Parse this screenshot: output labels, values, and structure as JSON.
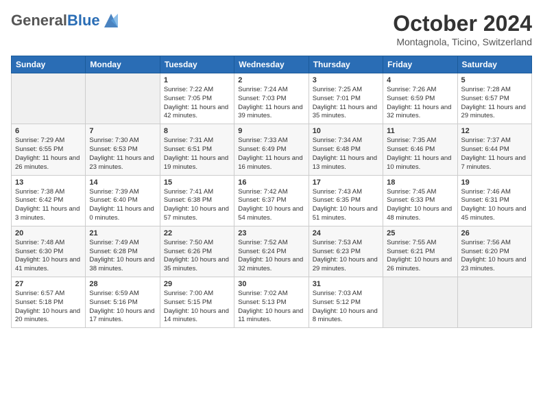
{
  "header": {
    "logo_general": "General",
    "logo_blue": "Blue",
    "title": "October 2024",
    "location": "Montagnola, Ticino, Switzerland"
  },
  "weekdays": [
    "Sunday",
    "Monday",
    "Tuesday",
    "Wednesday",
    "Thursday",
    "Friday",
    "Saturday"
  ],
  "weeks": [
    [
      {
        "day": "",
        "sunrise": "",
        "sunset": "",
        "daylight": ""
      },
      {
        "day": "",
        "sunrise": "",
        "sunset": "",
        "daylight": ""
      },
      {
        "day": "1",
        "sunrise": "Sunrise: 7:22 AM",
        "sunset": "Sunset: 7:05 PM",
        "daylight": "Daylight: 11 hours and 42 minutes."
      },
      {
        "day": "2",
        "sunrise": "Sunrise: 7:24 AM",
        "sunset": "Sunset: 7:03 PM",
        "daylight": "Daylight: 11 hours and 39 minutes."
      },
      {
        "day": "3",
        "sunrise": "Sunrise: 7:25 AM",
        "sunset": "Sunset: 7:01 PM",
        "daylight": "Daylight: 11 hours and 35 minutes."
      },
      {
        "day": "4",
        "sunrise": "Sunrise: 7:26 AM",
        "sunset": "Sunset: 6:59 PM",
        "daylight": "Daylight: 11 hours and 32 minutes."
      },
      {
        "day": "5",
        "sunrise": "Sunrise: 7:28 AM",
        "sunset": "Sunset: 6:57 PM",
        "daylight": "Daylight: 11 hours and 29 minutes."
      }
    ],
    [
      {
        "day": "6",
        "sunrise": "Sunrise: 7:29 AM",
        "sunset": "Sunset: 6:55 PM",
        "daylight": "Daylight: 11 hours and 26 minutes."
      },
      {
        "day": "7",
        "sunrise": "Sunrise: 7:30 AM",
        "sunset": "Sunset: 6:53 PM",
        "daylight": "Daylight: 11 hours and 23 minutes."
      },
      {
        "day": "8",
        "sunrise": "Sunrise: 7:31 AM",
        "sunset": "Sunset: 6:51 PM",
        "daylight": "Daylight: 11 hours and 19 minutes."
      },
      {
        "day": "9",
        "sunrise": "Sunrise: 7:33 AM",
        "sunset": "Sunset: 6:49 PM",
        "daylight": "Daylight: 11 hours and 16 minutes."
      },
      {
        "day": "10",
        "sunrise": "Sunrise: 7:34 AM",
        "sunset": "Sunset: 6:48 PM",
        "daylight": "Daylight: 11 hours and 13 minutes."
      },
      {
        "day": "11",
        "sunrise": "Sunrise: 7:35 AM",
        "sunset": "Sunset: 6:46 PM",
        "daylight": "Daylight: 11 hours and 10 minutes."
      },
      {
        "day": "12",
        "sunrise": "Sunrise: 7:37 AM",
        "sunset": "Sunset: 6:44 PM",
        "daylight": "Daylight: 11 hours and 7 minutes."
      }
    ],
    [
      {
        "day": "13",
        "sunrise": "Sunrise: 7:38 AM",
        "sunset": "Sunset: 6:42 PM",
        "daylight": "Daylight: 11 hours and 3 minutes."
      },
      {
        "day": "14",
        "sunrise": "Sunrise: 7:39 AM",
        "sunset": "Sunset: 6:40 PM",
        "daylight": "Daylight: 11 hours and 0 minutes."
      },
      {
        "day": "15",
        "sunrise": "Sunrise: 7:41 AM",
        "sunset": "Sunset: 6:38 PM",
        "daylight": "Daylight: 10 hours and 57 minutes."
      },
      {
        "day": "16",
        "sunrise": "Sunrise: 7:42 AM",
        "sunset": "Sunset: 6:37 PM",
        "daylight": "Daylight: 10 hours and 54 minutes."
      },
      {
        "day": "17",
        "sunrise": "Sunrise: 7:43 AM",
        "sunset": "Sunset: 6:35 PM",
        "daylight": "Daylight: 10 hours and 51 minutes."
      },
      {
        "day": "18",
        "sunrise": "Sunrise: 7:45 AM",
        "sunset": "Sunset: 6:33 PM",
        "daylight": "Daylight: 10 hours and 48 minutes."
      },
      {
        "day": "19",
        "sunrise": "Sunrise: 7:46 AM",
        "sunset": "Sunset: 6:31 PM",
        "daylight": "Daylight: 10 hours and 45 minutes."
      }
    ],
    [
      {
        "day": "20",
        "sunrise": "Sunrise: 7:48 AM",
        "sunset": "Sunset: 6:30 PM",
        "daylight": "Daylight: 10 hours and 41 minutes."
      },
      {
        "day": "21",
        "sunrise": "Sunrise: 7:49 AM",
        "sunset": "Sunset: 6:28 PM",
        "daylight": "Daylight: 10 hours and 38 minutes."
      },
      {
        "day": "22",
        "sunrise": "Sunrise: 7:50 AM",
        "sunset": "Sunset: 6:26 PM",
        "daylight": "Daylight: 10 hours and 35 minutes."
      },
      {
        "day": "23",
        "sunrise": "Sunrise: 7:52 AM",
        "sunset": "Sunset: 6:24 PM",
        "daylight": "Daylight: 10 hours and 32 minutes."
      },
      {
        "day": "24",
        "sunrise": "Sunrise: 7:53 AM",
        "sunset": "Sunset: 6:23 PM",
        "daylight": "Daylight: 10 hours and 29 minutes."
      },
      {
        "day": "25",
        "sunrise": "Sunrise: 7:55 AM",
        "sunset": "Sunset: 6:21 PM",
        "daylight": "Daylight: 10 hours and 26 minutes."
      },
      {
        "day": "26",
        "sunrise": "Sunrise: 7:56 AM",
        "sunset": "Sunset: 6:20 PM",
        "daylight": "Daylight: 10 hours and 23 minutes."
      }
    ],
    [
      {
        "day": "27",
        "sunrise": "Sunrise: 6:57 AM",
        "sunset": "Sunset: 5:18 PM",
        "daylight": "Daylight: 10 hours and 20 minutes."
      },
      {
        "day": "28",
        "sunrise": "Sunrise: 6:59 AM",
        "sunset": "Sunset: 5:16 PM",
        "daylight": "Daylight: 10 hours and 17 minutes."
      },
      {
        "day": "29",
        "sunrise": "Sunrise: 7:00 AM",
        "sunset": "Sunset: 5:15 PM",
        "daylight": "Daylight: 10 hours and 14 minutes."
      },
      {
        "day": "30",
        "sunrise": "Sunrise: 7:02 AM",
        "sunset": "Sunset: 5:13 PM",
        "daylight": "Daylight: 10 hours and 11 minutes."
      },
      {
        "day": "31",
        "sunrise": "Sunrise: 7:03 AM",
        "sunset": "Sunset: 5:12 PM",
        "daylight": "Daylight: 10 hours and 8 minutes."
      },
      {
        "day": "",
        "sunrise": "",
        "sunset": "",
        "daylight": ""
      },
      {
        "day": "",
        "sunrise": "",
        "sunset": "",
        "daylight": ""
      }
    ]
  ]
}
